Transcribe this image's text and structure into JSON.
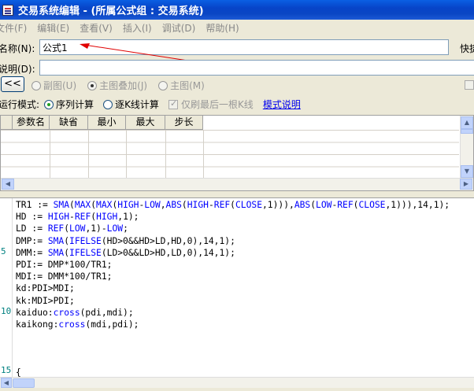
{
  "window": {
    "title": "交易系统编辑 - (所属公式组 : 交易系统)"
  },
  "menu": [
    "文件(F)",
    "编辑(E)",
    "查看(V)",
    "插入(I)",
    "调试(D)",
    "帮助(H)"
  ],
  "name_row": {
    "label": "名称(N):",
    "value": "公式1",
    "right_label": "快捷"
  },
  "desc_row": {
    "label": "说明(D):",
    "value": ""
  },
  "chart_row": {
    "back_label": "<<",
    "options": [
      "副图(U)",
      "主图叠加(J)",
      "主图(M)"
    ]
  },
  "mode_row": {
    "label": "运行模式:",
    "options": [
      "序列计算",
      "逐K线计算"
    ],
    "check_label": "仅刷最后一根K线",
    "link": "模式说明"
  },
  "params_table": {
    "columns": [
      "参数名",
      "缺省",
      "最小",
      "最大",
      "步长"
    ]
  },
  "editor": {
    "line_numbers": [
      "5",
      "10",
      "15"
    ],
    "lines": [
      "TR1 := SMA(MAX(MAX(HIGH-LOW,ABS(HIGH-REF(CLOSE,1))),ABS(LOW-REF(CLOSE,1))),14,1);",
      "HD := HIGH-REF(HIGH,1);",
      "LD := REF(LOW,1)-LOW;",
      "DMP:= SMA(IFELSE(HD>0&&HD>LD,HD,0),14,1);",
      "DMM:= SMA(IFELSE(LD>0&&LD>HD,LD,0),14,1);",
      "PDI:= DMP*100/TR1;",
      "MDI:= DMM*100/TR1;",
      "kd:PDI>MDI;",
      "kk:MDI>PDI;",
      "kaiduo:cross(pdi,mdi);",
      "kaikong:cross(mdi,pdi);",
      "",
      "",
      "",
      "{"
    ]
  },
  "colors": {
    "keyword": "#0000ff",
    "code": "#000000",
    "line_number": "#008080",
    "annotation_arrow": "#e00000"
  }
}
